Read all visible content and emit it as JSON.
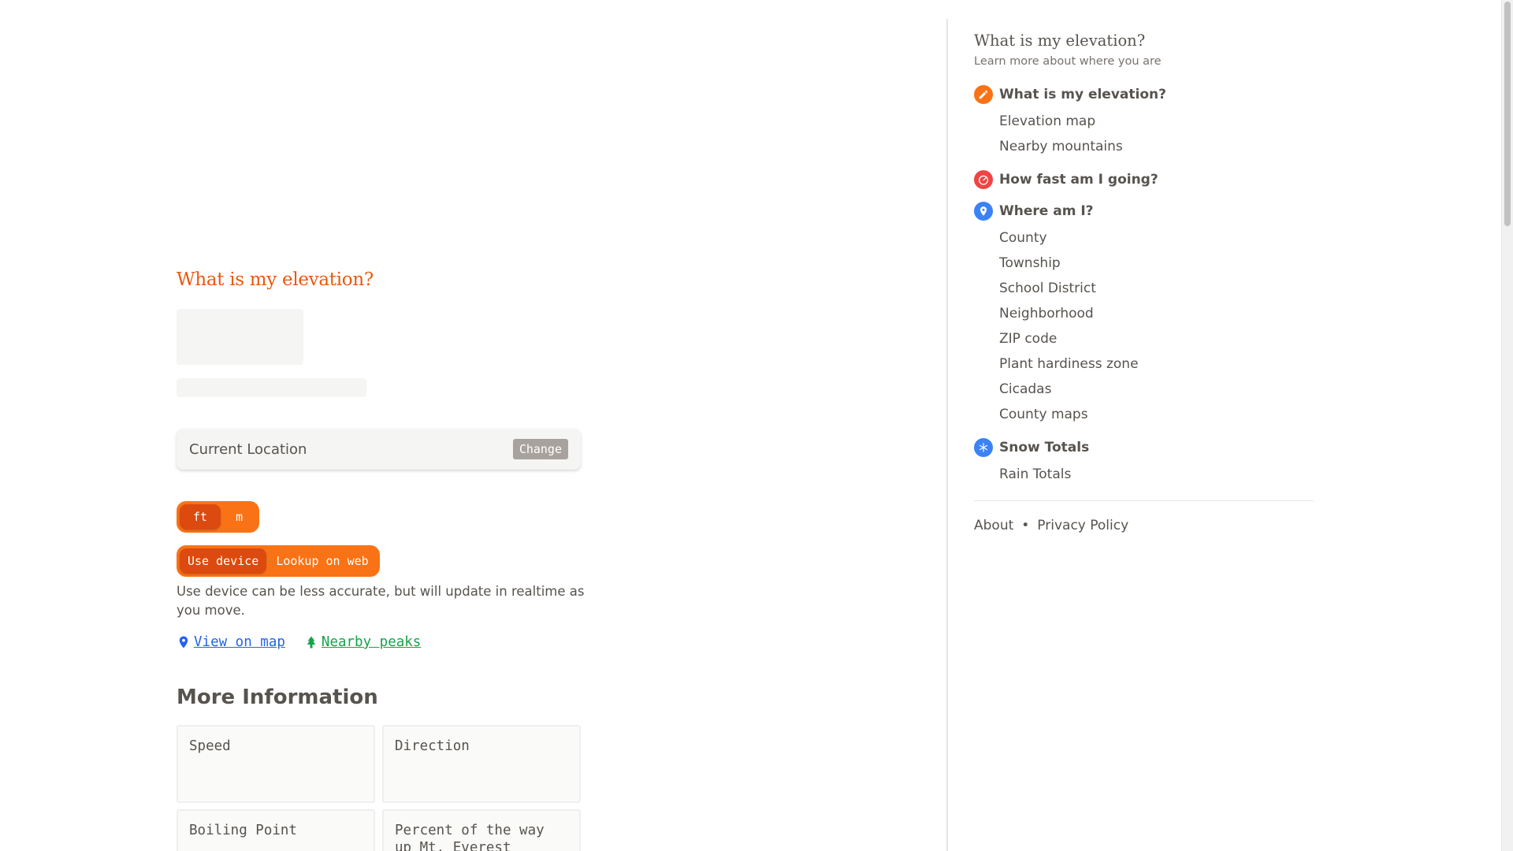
{
  "main": {
    "title": "What is my elevation?",
    "location": {
      "label": "Current Location",
      "change_label": "Change"
    },
    "units": {
      "options": [
        "ft",
        "m"
      ],
      "selected": "ft"
    },
    "source": {
      "options": [
        "Use device",
        "Lookup on web"
      ],
      "selected": "Use device",
      "note": "Use device can be less accurate, but will update in realtime as you move."
    },
    "links": {
      "map": "View on map",
      "peaks": "Nearby peaks"
    },
    "more_info": {
      "title": "More Information",
      "cards": [
        "Speed",
        "Direction",
        "Boiling Point",
        "Percent of the way up Mt. Everest"
      ]
    }
  },
  "sidebar": {
    "title": "What is my elevation?",
    "subtitle": "Learn more about where you are",
    "sections": [
      {
        "label": "What is my elevation?",
        "icon": "pencil-icon",
        "color": "#f97316",
        "items": [
          "Elevation map",
          "Nearby mountains"
        ]
      },
      {
        "label": "How fast am I going?",
        "icon": "speedometer-icon",
        "color": "#ef4444",
        "items": []
      },
      {
        "label": "Where am I?",
        "icon": "location-pin-icon",
        "color": "#3b82f6",
        "items": [
          "County",
          "Township",
          "School District",
          "Neighborhood",
          "ZIP code",
          "Plant hardiness zone",
          "Cicadas",
          "County maps"
        ]
      },
      {
        "label": "Snow Totals",
        "icon": "snowflake-icon",
        "color": "#3b82f6",
        "items": [
          "Rain Totals"
        ]
      }
    ],
    "footer": {
      "about": "About",
      "separator": "•",
      "privacy": "Privacy Policy"
    }
  },
  "colors": {
    "accent": "#ea580c",
    "toggle_bg": "#f97316",
    "link_map": "#2563eb",
    "link_peaks": "#16a34a",
    "text": "#57534e"
  }
}
